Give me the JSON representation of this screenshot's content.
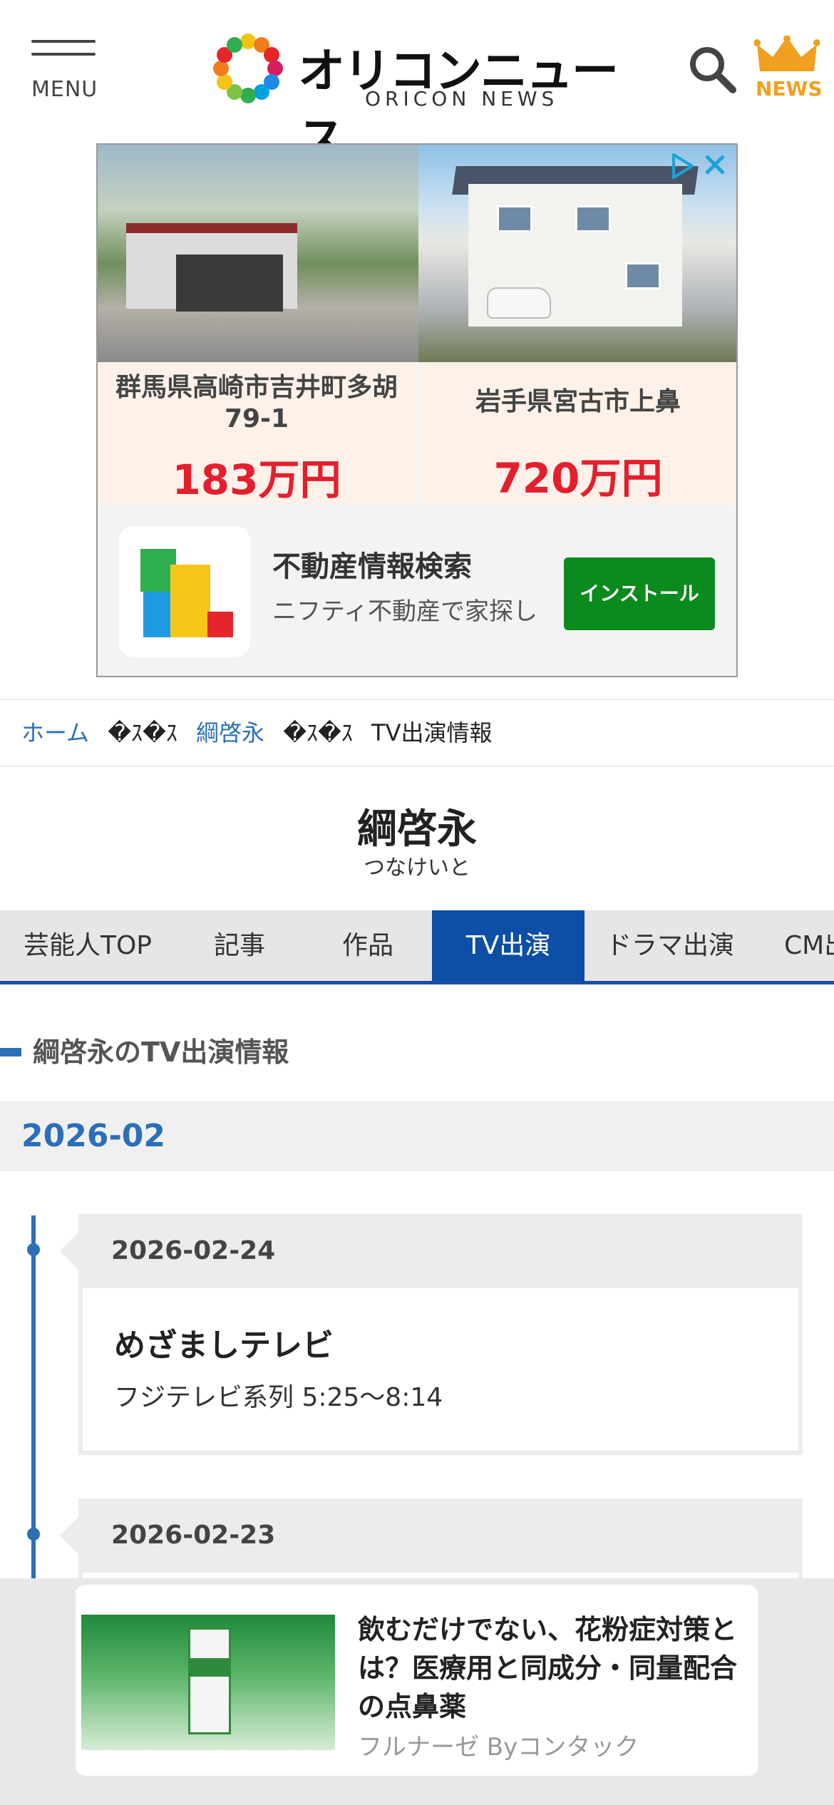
{
  "header": {
    "menu_label": "MENU",
    "logo_title": "オリコンニュース",
    "logo_subtitle": "ORICON NEWS",
    "news_label": "NEWS"
  },
  "ad": {
    "left_location": "群馬県高崎市吉井町多胡79-1",
    "left_price": "183万円",
    "right_location": "岩手県宮古市上鼻",
    "right_price": "720万円",
    "app_title": "不動産情報検索",
    "app_desc": "ニフティ不動産で家探し",
    "install_label": "インストール",
    "price_color": "#e41f2d",
    "install_color": "#0b8a1e"
  },
  "breadcrumb": {
    "home": "ホーム",
    "separator": "�ｽ�ｽ",
    "person": "綱啓永",
    "current": "TV出演情報"
  },
  "profile": {
    "name": "綱啓永",
    "kana": "つなけいと"
  },
  "tabs": [
    {
      "label": "芸能人TOP",
      "active": false
    },
    {
      "label": "記事",
      "active": false
    },
    {
      "label": "作品",
      "active": false
    },
    {
      "label": "TV出演",
      "active": true
    },
    {
      "label": "ドラマ出演",
      "active": false
    },
    {
      "label": "CM出演",
      "active": false
    }
  ],
  "section": {
    "title": "綱啓永のTV出演情報"
  },
  "month": "2026-02",
  "entries": [
    {
      "date": "2026-02-24",
      "title": "めざましテレビ",
      "info": "フジテレビ系列 5:25〜8:14"
    },
    {
      "date": "2026-02-23",
      "title": "",
      "info": ""
    }
  ],
  "bottom_ad": {
    "title": "飲むだけでない、花粉症対策とは？医療用と同成分・同量配合の点鼻薬",
    "source": "フルナーゼ Byコンタック"
  },
  "colors": {
    "accent": "#2a6fb8",
    "tab_active": "#0d4ea6",
    "logo_crown": "#f0a020"
  }
}
